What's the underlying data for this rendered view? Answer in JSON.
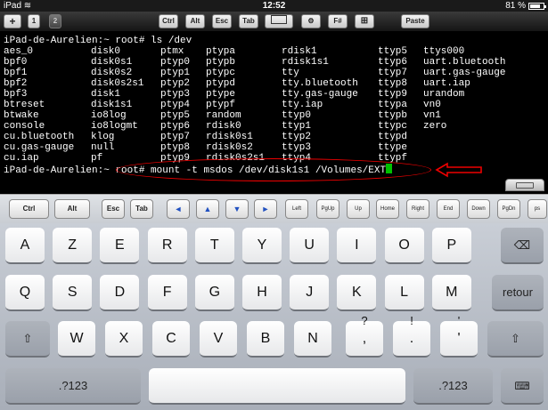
{
  "status": {
    "device": "iPad",
    "time": "12:52",
    "battery": "81 %",
    "battery_level": 0.81
  },
  "toolbar": {
    "add": "+",
    "tab1": "1",
    "tab2": "2",
    "ctrl": "Ctrl",
    "alt": "Alt",
    "esc": "Esc",
    "tab": "Tab",
    "fn": "F#",
    "paste": "Paste"
  },
  "terminal": {
    "prompt1": "iPad-de-Aurelien:~ root# ls /dev",
    "listing": [
      [
        "aes_0",
        "disk0",
        "ptmx",
        "ptypa",
        "rdisk1",
        "ttyp5",
        "ttys000"
      ],
      [
        "bpf0",
        "disk0s1",
        "ptyp0",
        "ptypb",
        "rdisk1s1",
        "ttyp6",
        "uart.bluetooth"
      ],
      [
        "bpf1",
        "disk0s2",
        "ptyp1",
        "ptypc",
        "tty",
        "ttyp7",
        "uart.gas-gauge"
      ],
      [
        "bpf2",
        "disk0s2s1",
        "ptyp2",
        "ptypd",
        "tty.bluetooth",
        "ttyp8",
        "uart.iap"
      ],
      [
        "bpf3",
        "disk1",
        "ptyp3",
        "ptype",
        "tty.gas-gauge",
        "ttyp9",
        "urandom"
      ],
      [
        "btreset",
        "disk1s1",
        "ptyp4",
        "ptypf",
        "tty.iap",
        "ttypa",
        "vn0"
      ],
      [
        "btwake",
        "io8log",
        "ptyp5",
        "random",
        "ttyp0",
        "ttypb",
        "vn1"
      ],
      [
        "console",
        "io8logmt",
        "ptyp6",
        "rdisk0",
        "ttyp1",
        "ttypc",
        "zero"
      ],
      [
        "cu.bluetooth",
        "klog",
        "ptyp7",
        "rdisk0s1",
        "ttyp2",
        "ttypd",
        ""
      ],
      [
        "cu.gas-gauge",
        "null",
        "ptyp8",
        "rdisk0s2",
        "ttyp3",
        "ttype",
        ""
      ],
      [
        "cu.iap",
        "pf",
        "ptyp9",
        "rdisk0s2s1",
        "ttyp4",
        "ttypf",
        ""
      ]
    ],
    "prompt2_host": "iPad-de-Aurelien:~",
    "prompt2_cmd": "root# mount -t msdos /dev/disk1s1 /Volumes/EXT"
  },
  "keyrow": {
    "ctrl": "Ctrl",
    "alt": "Alt",
    "esc": "Esc",
    "tab": "Tab",
    "left_arrow": "◄",
    "up_arrow": "▲",
    "down_arrow": "▼",
    "right_arrow": "►",
    "left": "Left",
    "pgup": "PgUp",
    "up": "Up",
    "home": "Home",
    "right": "Right",
    "end": "End",
    "down": "Down",
    "pgdn": "PgDn",
    "ps": "ps"
  },
  "keyboard": {
    "row1": [
      "A",
      "Z",
      "E",
      "R",
      "T",
      "Y",
      "U",
      "I",
      "O",
      "P"
    ],
    "row2": [
      "Q",
      "S",
      "D",
      "F",
      "G",
      "H",
      "J",
      "K",
      "L",
      "M"
    ],
    "row3": [
      "W",
      "X",
      "C",
      "V",
      "B",
      "N"
    ],
    "comma_top": "?",
    "comma_bottom": ",",
    "period_top": "!",
    "period_bottom": ".",
    "quote_top": "'",
    "quote_bottom": "'",
    "return": "retour",
    "numbers_left": ".?123",
    "numbers_right": ".?123"
  },
  "colors": {
    "cursor": "#00c000",
    "annotation": "#e00000"
  }
}
